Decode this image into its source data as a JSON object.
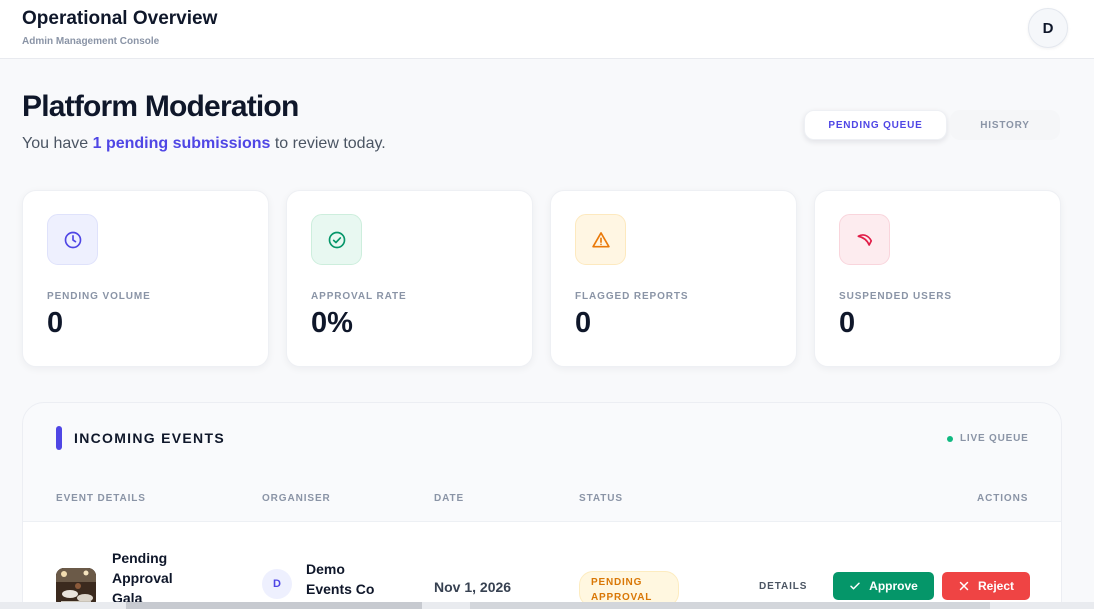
{
  "header": {
    "title": "Operational Overview",
    "subtitle": "Admin Management Console",
    "avatar_initial": "D"
  },
  "page": {
    "title": "Platform Moderation",
    "subtitle_prefix": "You have ",
    "subtitle_highlight": "1 pending submissions",
    "subtitle_suffix": " to review today."
  },
  "tabs": [
    {
      "label": "PENDING QUEUE",
      "active": true
    },
    {
      "label": "HISTORY",
      "active": false
    }
  ],
  "stats": [
    {
      "icon": "clock-icon",
      "label": "PENDING VOLUME",
      "value": "0",
      "color": "#4f46e5",
      "bg": "#eef0fe"
    },
    {
      "icon": "check-circle-icon",
      "label": "APPROVAL RATE",
      "value": "0%",
      "color": "#059669",
      "bg": "#e8f8f1"
    },
    {
      "icon": "warning-triangle-icon",
      "label": "FLAGGED REPORTS",
      "value": "0",
      "color": "#ea7a0a",
      "bg": "#fff6e3"
    },
    {
      "icon": "ban-icon",
      "label": "SUSPENDED USERS",
      "value": "0",
      "color": "#e11d48",
      "bg": "#fdecef"
    }
  ],
  "events": {
    "title": "INCOMING EVENTS",
    "live_label": "LIVE QUEUE",
    "columns": [
      "EVENT DETAILS",
      "ORGANISER",
      "DATE",
      "STATUS",
      "ACTIONS"
    ],
    "rows": [
      {
        "name": "Pending Approval Gala",
        "organiser_initial": "D",
        "organiser": "Demo Events Co",
        "date": "Nov 1, 2026",
        "status": "PENDING APPROVAL",
        "details_label": "DETAILS",
        "approve_label": "Approve",
        "reject_label": "Reject"
      }
    ]
  }
}
